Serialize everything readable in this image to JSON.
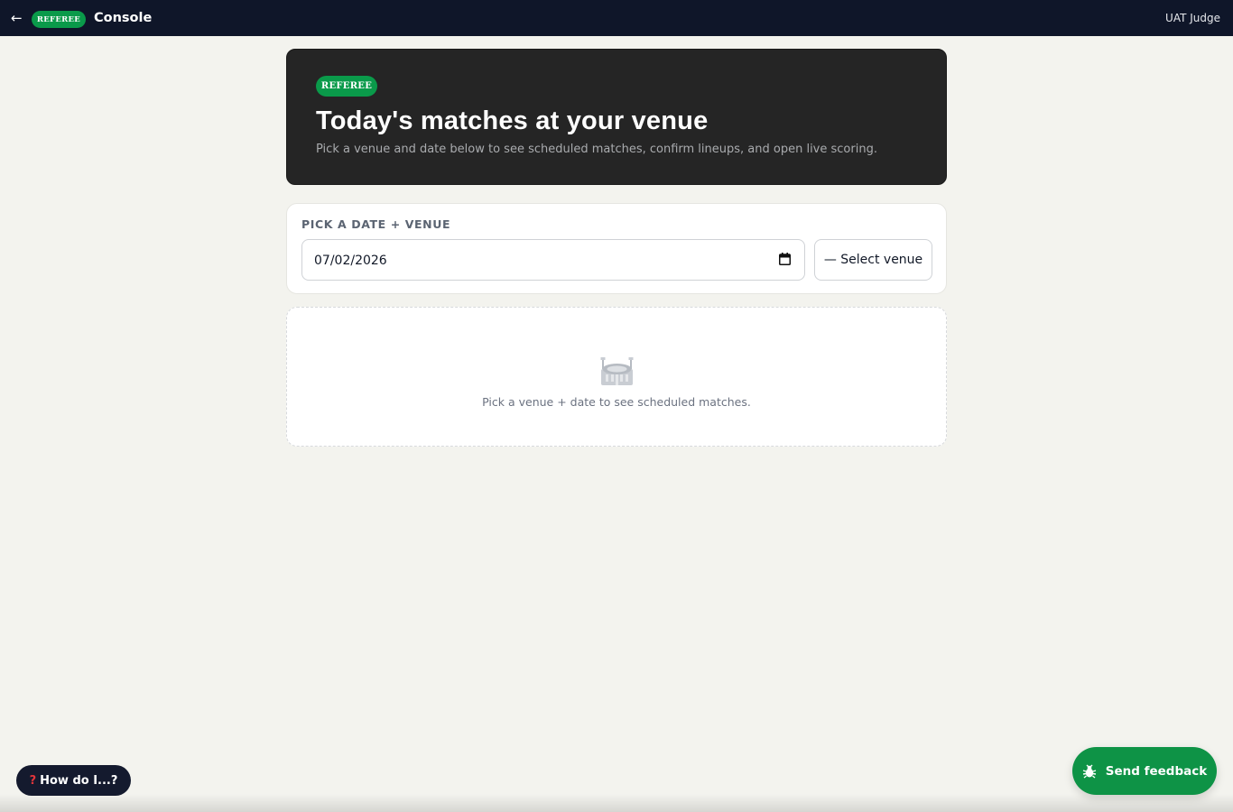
{
  "topbar": {
    "back_icon": "arrow-left-icon",
    "badge": "REFEREE",
    "title": "Console",
    "user": "UAT Judge"
  },
  "hero": {
    "badge": "REFEREE",
    "title": "Today's matches at your venue",
    "subtitle": "Pick a venue and date below to see scheduled matches, confirm lineups, and open live scoring."
  },
  "picker": {
    "label": "PICK A DATE + VENUE",
    "date_value": "07/02/2026",
    "venue_select": "— Select venue"
  },
  "empty_state": {
    "icon": "stadium-icon",
    "text": "Pick a venue + date to see scheduled matches."
  },
  "help": {
    "icon": "question-mark-icon",
    "icon_glyph": "?",
    "label": "How do I...?"
  },
  "feedback": {
    "icon": "bug-icon",
    "label": "Send feedback"
  },
  "colors": {
    "topbar_bg": "#0f1629",
    "accent_green": "#0a9a4a",
    "hero_bg": "#252525",
    "page_bg": "#f3f3ee"
  }
}
